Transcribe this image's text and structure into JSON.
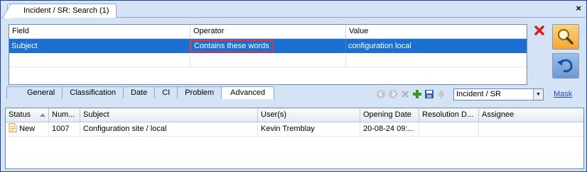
{
  "window": {
    "tab_label": "Incident / SR: Search (1)",
    "close_label": "×"
  },
  "criteria": {
    "columns": [
      "Field",
      "Operator",
      "Value"
    ],
    "rows": [
      {
        "field": "Subject",
        "operator": "Contains these words",
        "value": "configuration local"
      }
    ]
  },
  "criteria_tabs": [
    "General",
    "Classification",
    "Date",
    "CI",
    "Problem",
    "Advanced"
  ],
  "active_criteria_tab": "Advanced",
  "toolbar": {
    "entity_select": "Incident / SR",
    "mask_link": "Mask"
  },
  "results": {
    "columns": [
      "Status",
      "Num...",
      "Subject",
      "User(s)",
      "Opening Date",
      "Resolution D...",
      "Assignee"
    ],
    "rows": [
      {
        "status": "New",
        "number": "1007",
        "subject": "Configuration site / local",
        "users": "Kevin Tremblay",
        "opening_date": "20-08-24  09:...",
        "resolution_date": "",
        "assignee": ""
      }
    ]
  },
  "colors": {
    "selection": "#1b6fd1",
    "highlight_border": "#d8363c",
    "window_background": "#d5e3f6",
    "link": "#1b4bc4"
  }
}
